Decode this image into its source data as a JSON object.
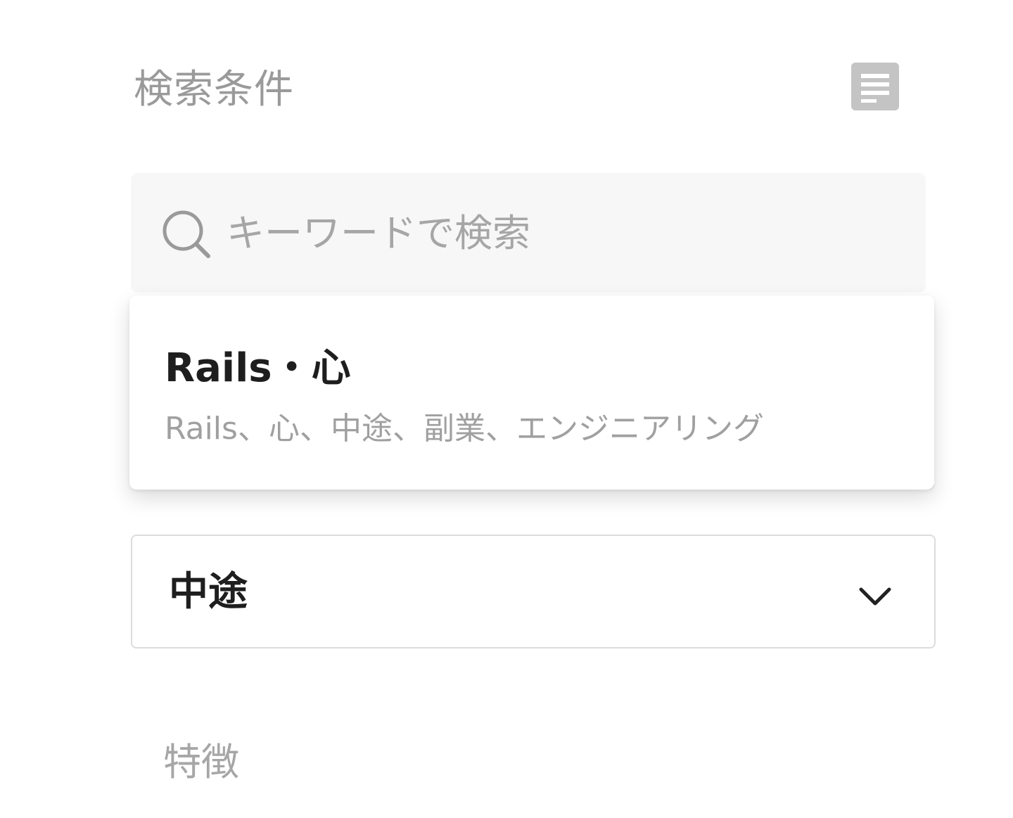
{
  "header": {
    "title": "検索条件",
    "icon": "list-icon"
  },
  "search": {
    "placeholder": "キーワードで検索",
    "value": "",
    "icon": "search-icon"
  },
  "suggestion": {
    "title": "Rails・心",
    "tags": "Rails、心、中途、副業、エンジニアリング"
  },
  "employment_select": {
    "value": "中途",
    "icon": "chevron-down-icon"
  },
  "features": {
    "label": "特徴"
  },
  "colors": {
    "muted_text": "#9a9a9a",
    "strong_text": "#1e1e1e",
    "search_bg": "#f7f7f7",
    "border": "#dcdcdc",
    "icon_gray": "#c4c4c4"
  }
}
